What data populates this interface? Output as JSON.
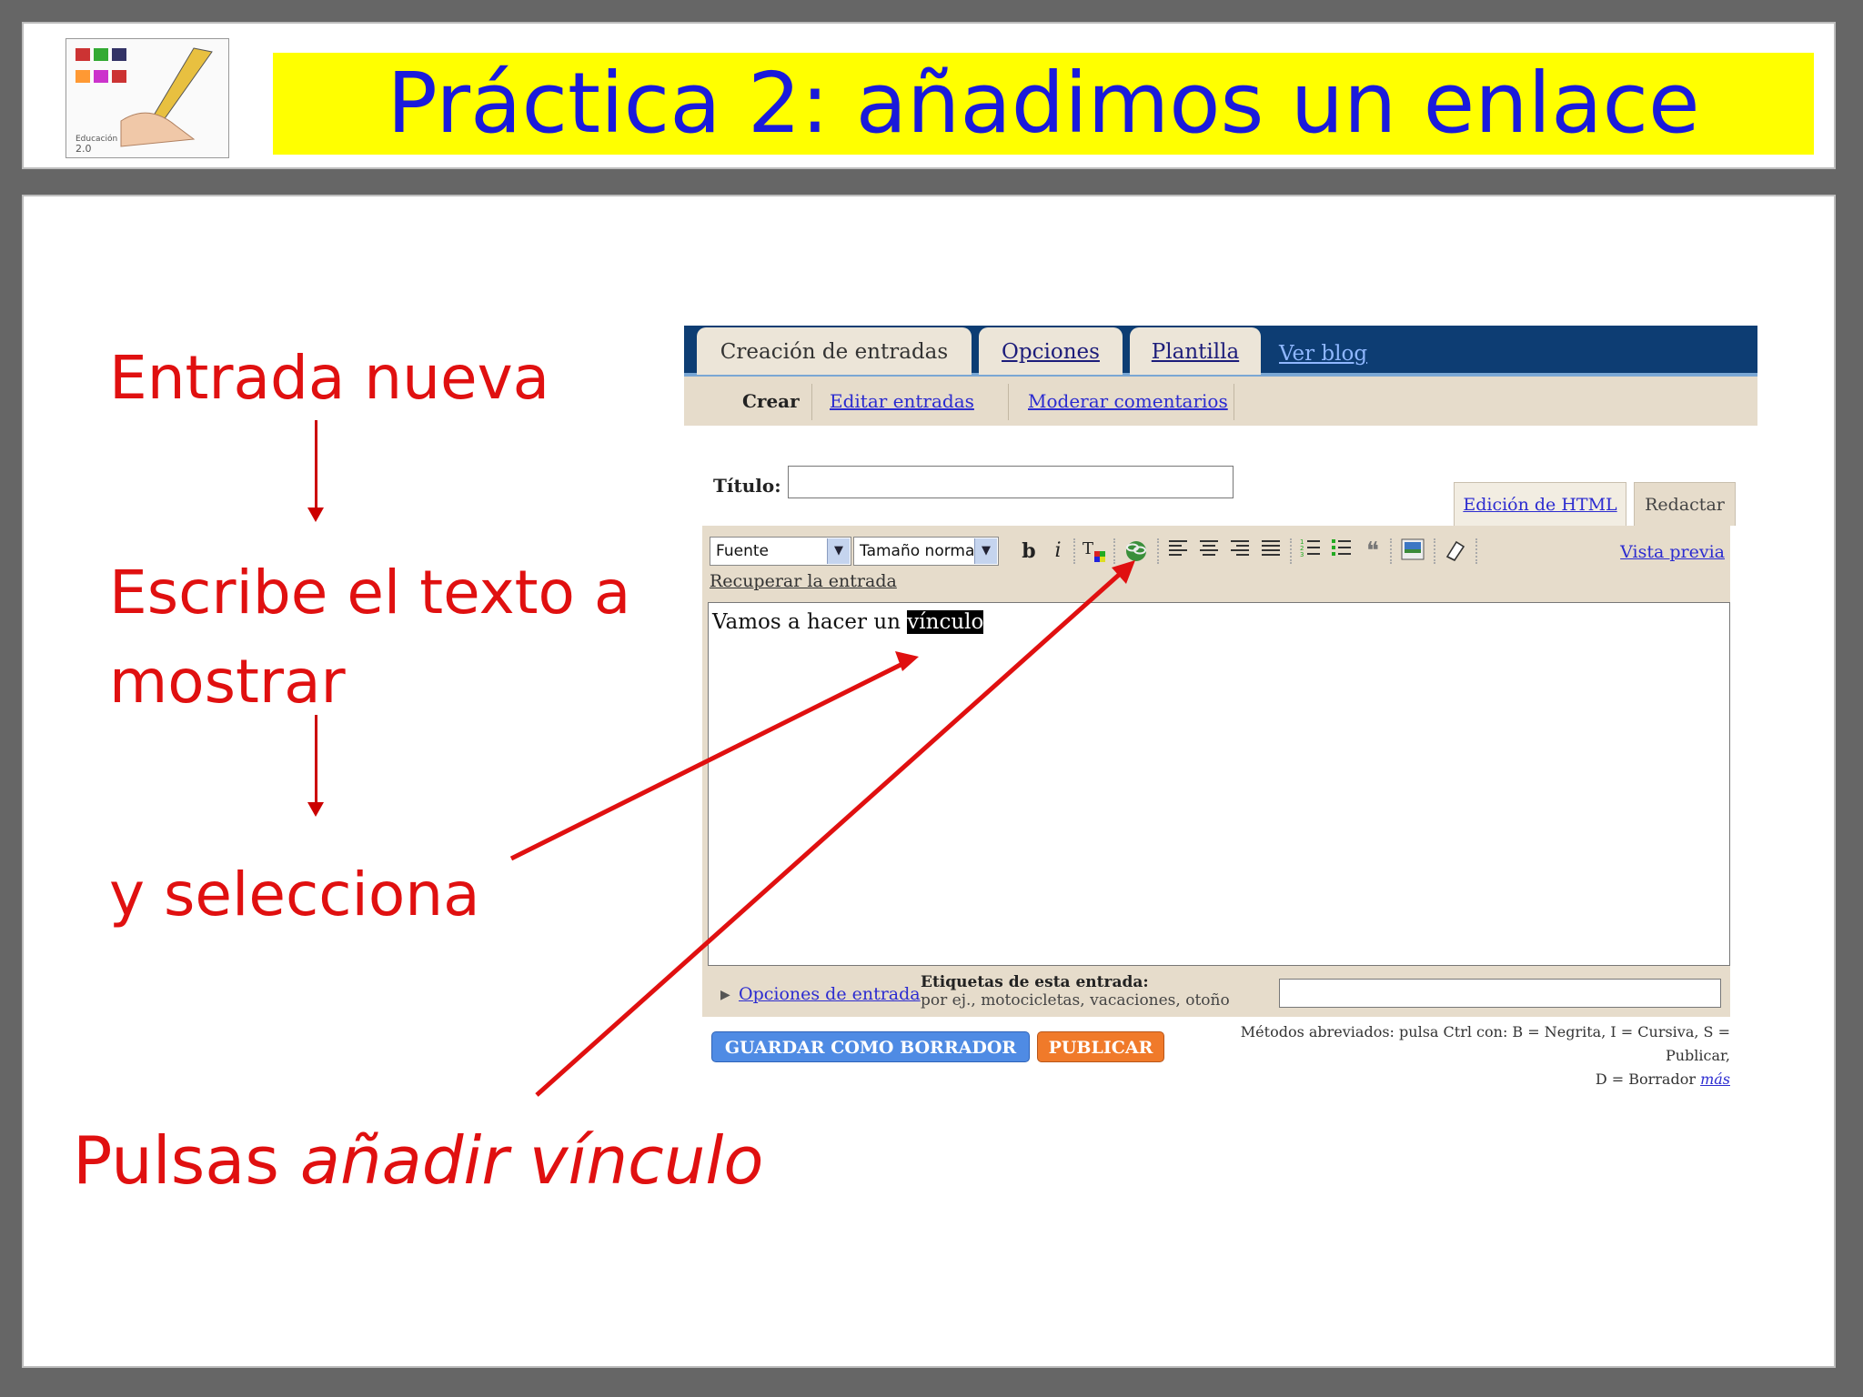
{
  "slide": {
    "title": "Práctica 2: añadimos un enlace",
    "steps": [
      {
        "text": "Entrada nueva"
      },
      {
        "text": "Escribe el texto a"
      },
      {
        "text": "mostrar"
      },
      {
        "text": "y  selecciona"
      }
    ],
    "final_step": {
      "prefix": "Pulsas ",
      "emphasis": "añadir vínculo"
    }
  },
  "colors": {
    "title_bg": "#ffff00",
    "title_text": "#1a1adb",
    "step_text": "#e01010",
    "arrow": "#cc0000"
  },
  "blogger": {
    "tabs": [
      {
        "label": "Creación de entradas"
      },
      {
        "label": "Opciones"
      },
      {
        "label": "Plantilla"
      },
      {
        "label": "Ver blog"
      }
    ],
    "subtabs": [
      {
        "label": "Crear"
      },
      {
        "label": "Editar entradas"
      },
      {
        "label": "Moderar comentarios"
      }
    ],
    "title_label": "Título:",
    "title_value": "",
    "mode_tabs": [
      {
        "label": "Edición de HTML"
      },
      {
        "label": "Redactar"
      }
    ],
    "toolbar": {
      "font_select": "Fuente",
      "size_select": "Tamaño normal",
      "icons": [
        "bold-icon",
        "italic-icon",
        "text-color-icon",
        "add-link-icon",
        "align-left-icon",
        "align-center-icon",
        "align-right-icon",
        "justify-icon",
        "numbered-list-icon",
        "bullet-list-icon",
        "blockquote-icon",
        "insert-image-icon",
        "clear-format-icon"
      ],
      "preview_label": "Vista previa"
    },
    "recover_label": "Recuperar la entrada",
    "body_text_before": "Vamos a hacer un ",
    "body_text_selected": "vínculo",
    "post_options_label": "Opciones de entrada",
    "labels_title": "Etiquetas de esta entrada:",
    "labels_example": "por ej., motocicletas, vacaciones, otoño",
    "save_draft_label": "GUARDAR COMO BORRADOR",
    "publish_label": "PUBLICAR",
    "shortcuts_line1": "Métodos abreviados: pulsa Ctrl con: B = Negrita, I = Cursiva, S = Publicar,",
    "shortcuts_line2": "D = Borrador",
    "shortcuts_more": "más"
  }
}
